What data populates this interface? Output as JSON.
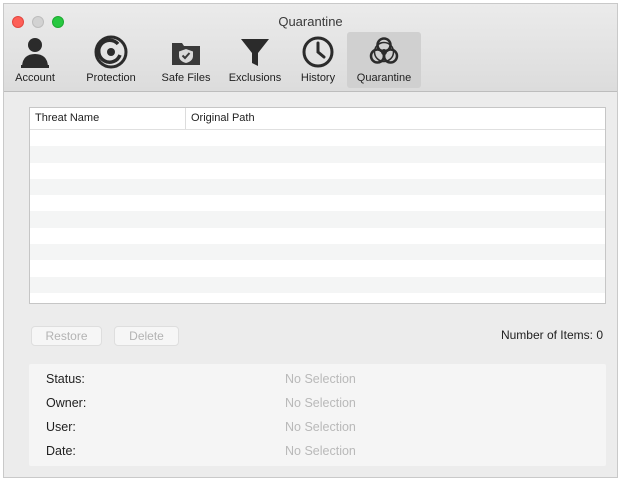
{
  "window": {
    "title": "Quarantine"
  },
  "toolbar": {
    "items": [
      {
        "label": "Account",
        "icon": "person-icon"
      },
      {
        "label": "Protection",
        "icon": "protection-icon"
      },
      {
        "label": "Safe Files",
        "icon": "shield-folder-icon"
      },
      {
        "label": "Exclusions",
        "icon": "filter-icon"
      },
      {
        "label": "History",
        "icon": "clock-icon"
      },
      {
        "label": "Quarantine",
        "icon": "biohazard-icon",
        "selected": true
      }
    ]
  },
  "table": {
    "columns": [
      "Threat Name",
      "Original Path"
    ],
    "rows": []
  },
  "actions": {
    "restore": "Restore",
    "delete": "Delete"
  },
  "items_count": {
    "label": "Number of Items:",
    "value": "0"
  },
  "details": [
    {
      "label": "Status:",
      "value": "No Selection"
    },
    {
      "label": "Owner:",
      "value": "No Selection"
    },
    {
      "label": "User:",
      "value": "No Selection"
    },
    {
      "label": "Date:",
      "value": "No Selection"
    }
  ],
  "colors": {
    "close": "#fd5f57",
    "zoom": "#27c840",
    "selected_tab": "#d0d0d0",
    "disabled_text": "#b3b3b3"
  }
}
